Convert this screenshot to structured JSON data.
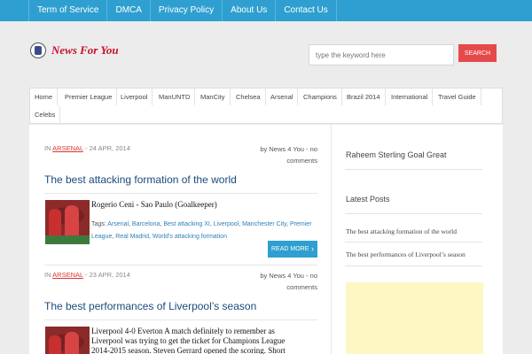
{
  "topnav": [
    "Term of Service",
    "DMCA",
    "Privacy Policy",
    "About Us",
    "Contact Us"
  ],
  "site": {
    "logo_text": "News For You"
  },
  "search": {
    "placeholder": "type the keyword here",
    "button": "SEARCH"
  },
  "categories": [
    "Home",
    "Premier League",
    "Liverpool",
    "ManUNTD",
    "ManCity",
    "Chelsea",
    "Arsenal",
    "Champions",
    "Brazil 2014",
    "International",
    "Travel Guide",
    "Celebs"
  ],
  "posts": [
    {
      "in_label": "IN",
      "category": "ARSENAL",
      "date": "- 24 APR, 2014",
      "author_line1": "by News 4 You - no",
      "author_line2": "comments",
      "title": "The best attacking formation of the world",
      "excerpt": "Rogerio Ceni - Sao Paulo (Goalkeeper)",
      "tags_label": "Tags:",
      "tags": [
        "Arsenal",
        "Barcelona",
        "Best attacking XI",
        "Liverpool",
        "Manchester City",
        "Premier League",
        "Real Madrid",
        "World's attacking formation"
      ],
      "read_more": "READ MORE"
    },
    {
      "in_label": "IN",
      "category": "ARSENAL",
      "date": "- 23 APR, 2014",
      "author_line1": "by News 4 You - no",
      "author_line2": "comments",
      "title": "The best performances of Liverpool’s season",
      "excerpt_lines": [
        "Liverpool 4-0 Everton A match definitely to remember as",
        "Liverpool was trying to get the ticket for Champions League",
        "2014-2015 season. Steven Gerrard opened the scoring. Short"
      ]
    }
  ],
  "sidebar": {
    "featured": "Raheem Sterling Goal Great",
    "latest_title": "Latest Posts",
    "latest": [
      "The best attacking formation of the world",
      "The best performances of Liverpool’s season"
    ]
  }
}
